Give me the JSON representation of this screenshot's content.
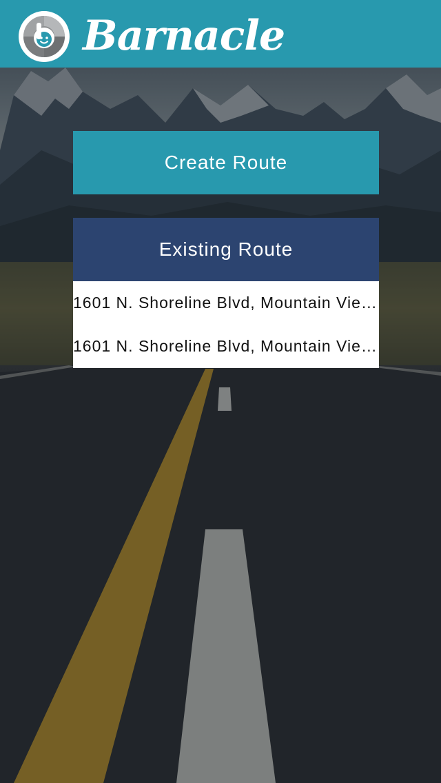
{
  "app": {
    "title": "Barnacle",
    "logo_icon": "barnacle-logo-icon",
    "header_color": "#2899ae"
  },
  "actions": {
    "create_route_label": "Create Route",
    "existing_route_label": "Existing Route",
    "create_color": "#2899ae",
    "existing_color": "#2c4470"
  },
  "routes": [
    {
      "address": "1601 N. Shoreline Blvd, Mountain View, CA"
    },
    {
      "address": "1601 N. Shoreline Blvd, Mountain View, CA"
    }
  ],
  "background": {
    "scene": "mountain-road-photo"
  }
}
